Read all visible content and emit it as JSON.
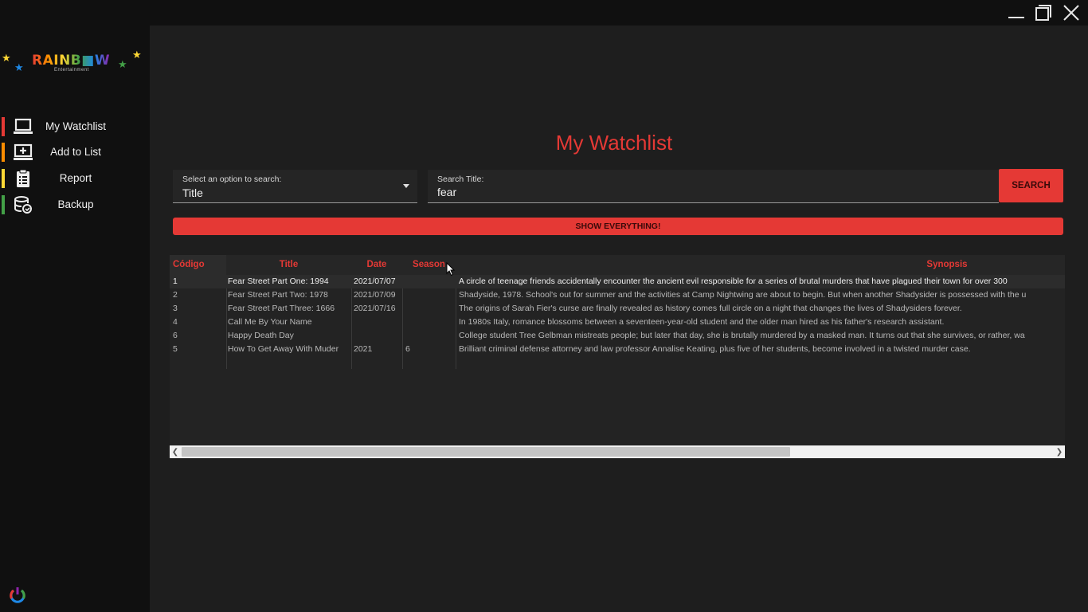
{
  "app": {
    "logo_text": "RAINB■W",
    "logo_subtext": "Entertainment"
  },
  "window_controls": [
    "minimize-icon",
    "maximize-icon",
    "close-icon"
  ],
  "sidebar": {
    "items": [
      {
        "label": "My Watchlist",
        "icon": "laptop-icon",
        "accent": "#e53935"
      },
      {
        "label": "Add to List",
        "icon": "add-box-icon",
        "accent": "#fb8c00"
      },
      {
        "label": "Report",
        "icon": "clipboard-icon",
        "accent": "#fdd835"
      },
      {
        "label": "Backup",
        "icon": "database-icon",
        "accent": "#43a047"
      }
    ],
    "power_icon": "power-icon"
  },
  "main": {
    "title": "My Watchlist",
    "search_option": {
      "label": "Select an option to search:",
      "value": "Title"
    },
    "search_title": {
      "label": "Search Title:",
      "value": "fear"
    },
    "search_button": "SEARCH",
    "show_all_button": "SHOW EVERYTHING!"
  },
  "table": {
    "columns": [
      "Código",
      "Title",
      "Date",
      "Season",
      "Synopsis"
    ],
    "rows": [
      [
        "1",
        "Fear Street Part One: 1994",
        "2021/07/07",
        "",
        "A circle of teenage friends accidentally encounter the ancient evil responsible for a series of brutal murders that have plagued their town for over 300"
      ],
      [
        "2",
        "Fear Street Part Two: 1978",
        "2021/07/09",
        "",
        "Shadyside, 1978. School's out for summer and the activities at Camp Nightwing are about to begin. But when another Shadysider is possessed with the u"
      ],
      [
        "3",
        "Fear Street Part Three: 1666",
        "2021/07/16",
        "",
        "The origins of Sarah Fier's curse are finally revealed as history comes full circle on a night that changes the lives of Shadysiders forever."
      ],
      [
        "4",
        "Call Me By Your Name",
        "",
        "",
        "In 1980s Italy, romance blossoms between a seventeen-year-old student and the older man hired as his father's research assistant."
      ],
      [
        "6",
        "Happy Death Day",
        "",
        "",
        "College student Tree Gelbman mistreats people; but later that day, she is brutally murdered by a masked man. It turns out that she survives, or rather, wa"
      ],
      [
        "5",
        "How To Get Away With Muder",
        "2021",
        "6",
        "Brilliant criminal defense attorney and law professor Annalise Keating, plus five of her students, become involved in a twisted murder case."
      ]
    ],
    "selected_row": 0
  },
  "colors": {
    "accent": "#e53935",
    "background": "#1e1e1e",
    "sidebar": "#101010"
  }
}
